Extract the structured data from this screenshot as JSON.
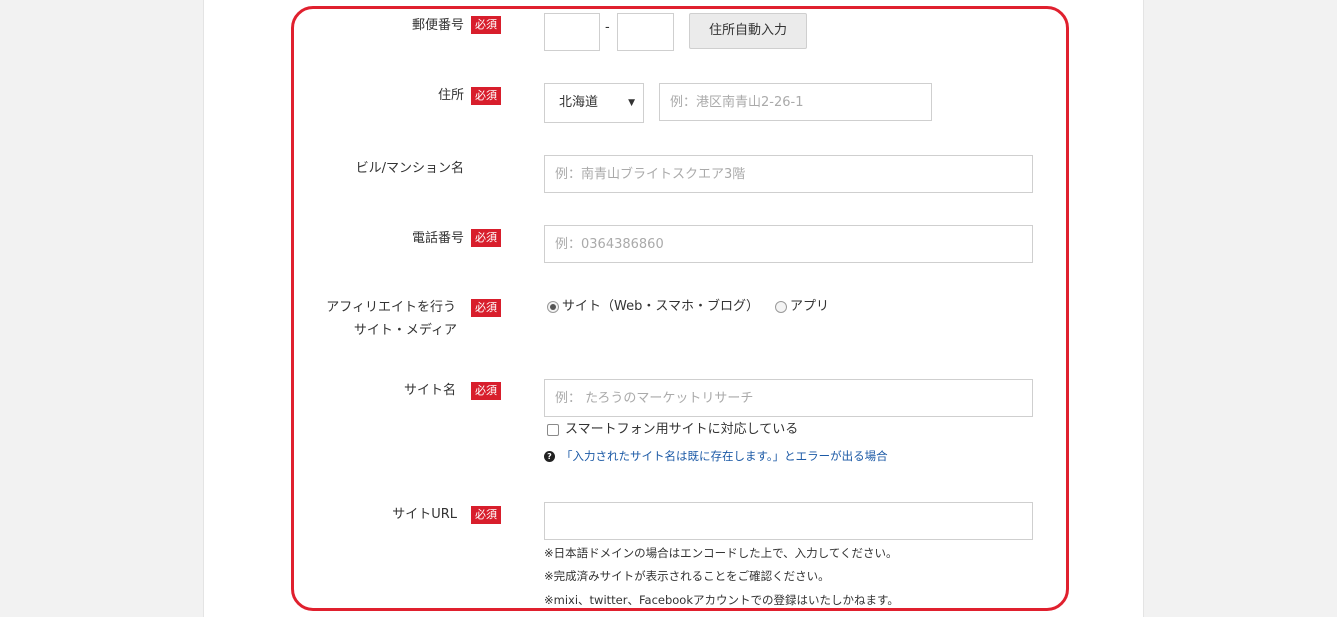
{
  "form": {
    "postal": {
      "label": "郵便番号",
      "required": "必須",
      "separator": "-",
      "autofill_button": "住所自動入力",
      "part1_value": "",
      "part2_value": ""
    },
    "address": {
      "label": "住所",
      "required": "必須",
      "prefecture_selected": "北海道",
      "placeholder": "例：港区南青山2-26-1"
    },
    "building": {
      "label": "ビル/マンション名",
      "placeholder": "例：南青山ブライトスクエア3階"
    },
    "phone": {
      "label": "電話番号",
      "required": "必須",
      "placeholder": "例：0364386860"
    },
    "media": {
      "label_line1": "アフィリエイトを行う",
      "label_line2": "サイト・メディア",
      "required": "必須",
      "option_site": "サイト（Web・スマホ・ブログ）",
      "option_app": "アプリ"
    },
    "site_name": {
      "label": "サイト名",
      "required": "必須",
      "placeholder": "例： たろうのマーケットリサーチ",
      "smartphone_checkbox": "スマートフォン用サイトに対応している",
      "help_link": "「入力されたサイト名は既に存在します。」とエラーが出る場合"
    },
    "site_url": {
      "label": "サイトURL",
      "required": "必須",
      "value": "",
      "notes": [
        "※日本語ドメインの場合はエンコードした上で、入力してください。",
        "※完成済みサイトが表示されることをご確認ください。",
        "※mixi、twitter、Facebookアカウントでの登録はいたしかねます。"
      ]
    }
  },
  "colors": {
    "required_badge": "#d81e2c",
    "highlight_border": "#e0202e",
    "link": "#1c5aa6"
  }
}
